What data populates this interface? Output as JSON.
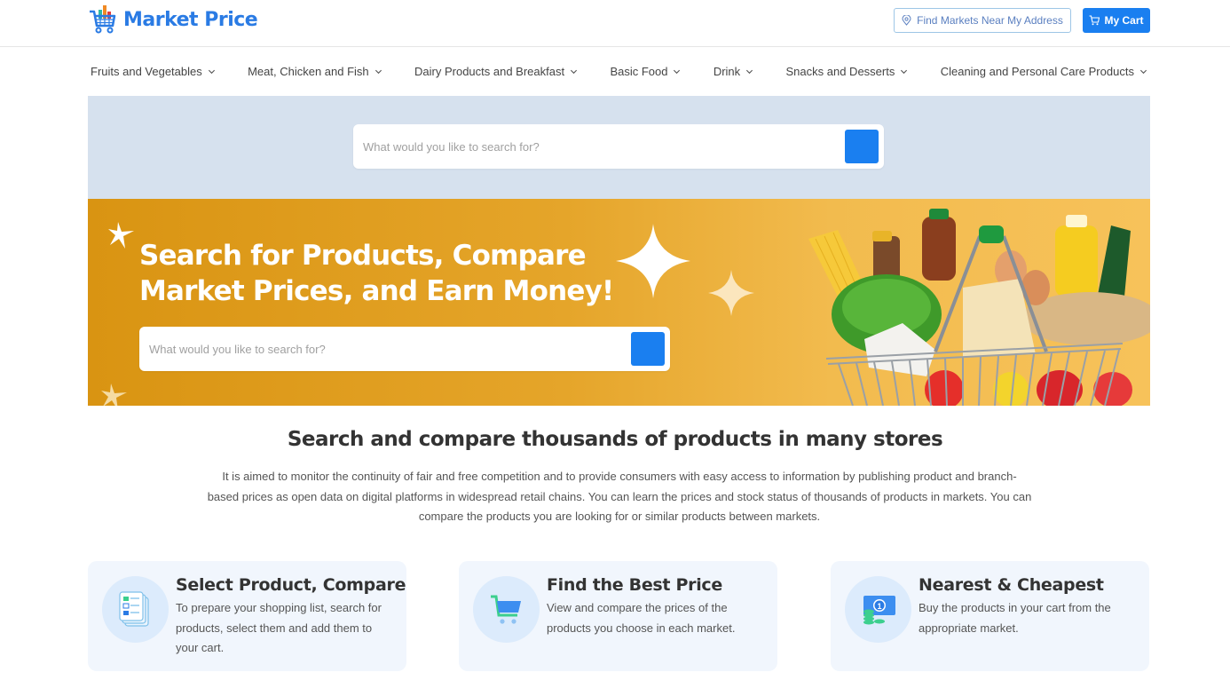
{
  "header": {
    "brand": "Market Price",
    "find_markets_label": "Find Markets Near My Address",
    "cart_label": "My Cart",
    "accent_color": "#1a7ff0"
  },
  "categories": [
    {
      "label": "Fruits and Vegetables"
    },
    {
      "label": "Meat, Chicken and Fish"
    },
    {
      "label": "Dairy Products and Breakfast"
    },
    {
      "label": "Basic Food"
    },
    {
      "label": "Drink"
    },
    {
      "label": "Snacks and Desserts"
    },
    {
      "label": "Cleaning and Personal Care Products"
    }
  ],
  "search_strip": {
    "placeholder": "What would you like to search for?",
    "value": ""
  },
  "hero": {
    "title_line1": "Search for Products, Compare",
    "title_line2": "Market Prices, and Earn Money!",
    "search_placeholder": "What would you like to search for?",
    "search_value": "",
    "image": "grocery-basket-illustration"
  },
  "info": {
    "title": "Search and compare thousands of products in many stores",
    "text": "It is aimed to monitor the continuity of fair and free competition and to provide consumers with easy access to information by publishing product and branch-based prices as open data on digital platforms in widespread retail chains. You can learn the prices and stock status of thousands of products in markets. You can compare the products you are looking for or similar products between markets."
  },
  "features": [
    {
      "icon": "checklist-icon",
      "title": "Select Product, Compare",
      "text": "To prepare your shopping list, search for products, select them and add them to your cart."
    },
    {
      "icon": "cart-icon",
      "title": "Find the Best Price",
      "text": "View and compare the prices of the products you choose in each market."
    },
    {
      "icon": "money-icon",
      "title": "Nearest & Cheapest",
      "text": "Buy the products in your cart from the appropriate market."
    }
  ]
}
